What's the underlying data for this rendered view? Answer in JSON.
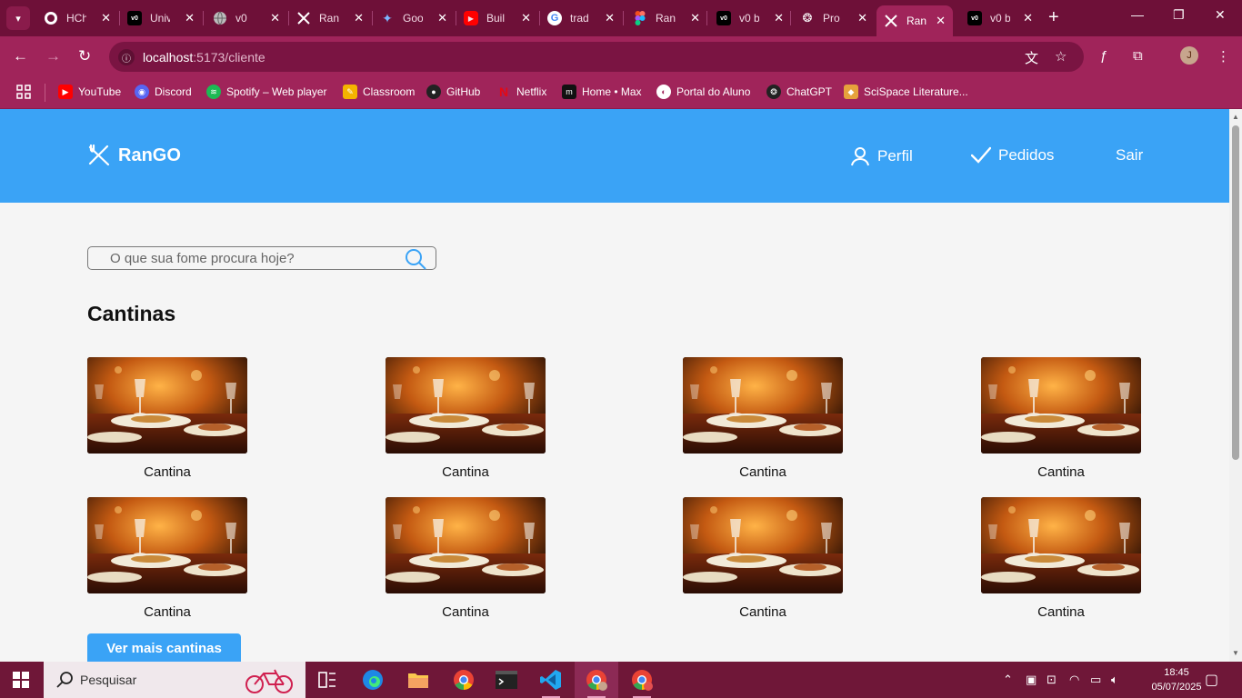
{
  "browser": {
    "tabs": [
      {
        "title": "HCh",
        "icon": "github-icon"
      },
      {
        "title": "Univ",
        "icon": "v0-icon"
      },
      {
        "title": "v0",
        "icon": "globe-icon"
      },
      {
        "title": "Ran",
        "icon": "utensils-icon"
      },
      {
        "title": "Goo",
        "icon": "gemini-icon"
      },
      {
        "title": "Buil",
        "icon": "youtube-icon"
      },
      {
        "title": "trad",
        "icon": "google-icon"
      },
      {
        "title": "Ran",
        "icon": "figma-icon"
      },
      {
        "title": "v0 b",
        "icon": "v0-icon"
      },
      {
        "title": "Pro",
        "icon": "openai-icon"
      },
      {
        "title": "Ran",
        "icon": "utensils-icon",
        "active": true
      },
      {
        "title": "v0 b",
        "icon": "v0-icon"
      }
    ],
    "url_host": "localhost",
    "url_path": ":5173/cliente",
    "profile_initial": "J",
    "bookmarks": [
      {
        "label": "YouTube",
        "icon": "youtube-icon",
        "color": "#ff0000"
      },
      {
        "label": "Discord",
        "icon": "discord-icon",
        "color": "#5865f2"
      },
      {
        "label": "Spotify – Web player",
        "icon": "spotify-icon",
        "color": "#1db954"
      },
      {
        "label": "Classroom",
        "icon": "classroom-icon",
        "color": "#f4b400"
      },
      {
        "label": "GitHub",
        "icon": "github-icon",
        "color": "#222222"
      },
      {
        "label": "Netflix",
        "icon": "netflix-icon",
        "color": "#e50914"
      },
      {
        "label": "Home • Max",
        "icon": "max-icon",
        "color": "#111111"
      },
      {
        "label": "Portal do Aluno",
        "icon": "portal-icon",
        "color": "#ffffff"
      },
      {
        "label": "ChatGPT",
        "icon": "openai-icon",
        "color": "#222222"
      },
      {
        "label": "SciSpace Literature...",
        "icon": "scispace-icon",
        "color": "#e6a23c"
      }
    ]
  },
  "app": {
    "brand": "RanGO",
    "nav": {
      "profile": "Perfil",
      "orders": "Pedidos",
      "logout": "Sair"
    },
    "search": {
      "placeholder": "O que sua fome procura hoje?"
    },
    "section_title": "Cantinas",
    "cards": [
      {
        "name": "Cantina"
      },
      {
        "name": "Cantina"
      },
      {
        "name": "Cantina"
      },
      {
        "name": "Cantina"
      },
      {
        "name": "Cantina"
      },
      {
        "name": "Cantina"
      },
      {
        "name": "Cantina"
      },
      {
        "name": "Cantina"
      }
    ],
    "more_button": "Ver mais cantinas",
    "accent_color": "#3aa3f6"
  },
  "taskbar": {
    "search_label": "Pesquisar",
    "time": "18:45",
    "date": "05/07/2025"
  }
}
